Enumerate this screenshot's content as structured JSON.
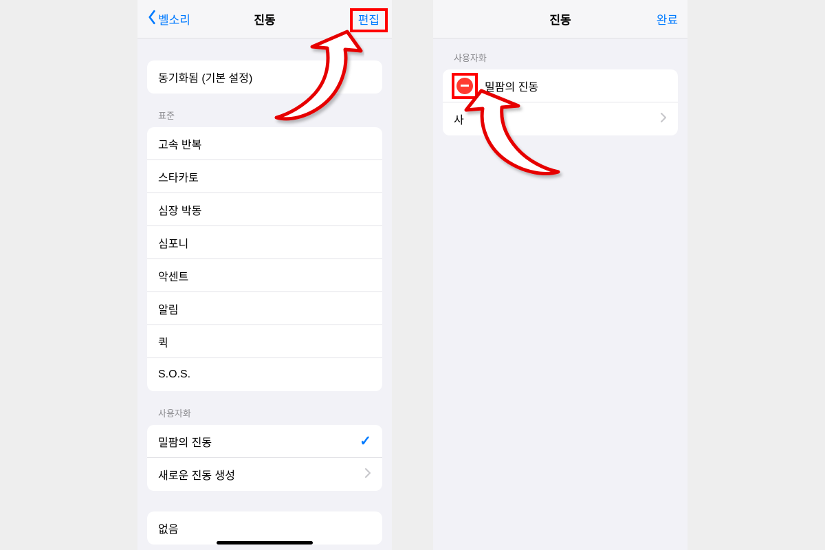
{
  "left": {
    "nav": {
      "back_label": "벨소리",
      "title": "진동",
      "right_label": "편집"
    },
    "synced_row": "동기화됨 (기본 설정)",
    "standard_header": "표준",
    "standard_items": [
      "고속 반복",
      "스타카토",
      "심장 박동",
      "심포니",
      "악센트",
      "알림",
      "퀵",
      "S.O.S."
    ],
    "custom_header": "사용자화",
    "custom_selected": "밀팜의 진동",
    "create_new": "새로운 진동 생성",
    "none_label": "없음"
  },
  "right": {
    "nav": {
      "title": "진동",
      "right_label": "완료"
    },
    "custom_header": "사용자화",
    "custom_item": "밀팜의 진동",
    "second_item_prefix": "사"
  }
}
